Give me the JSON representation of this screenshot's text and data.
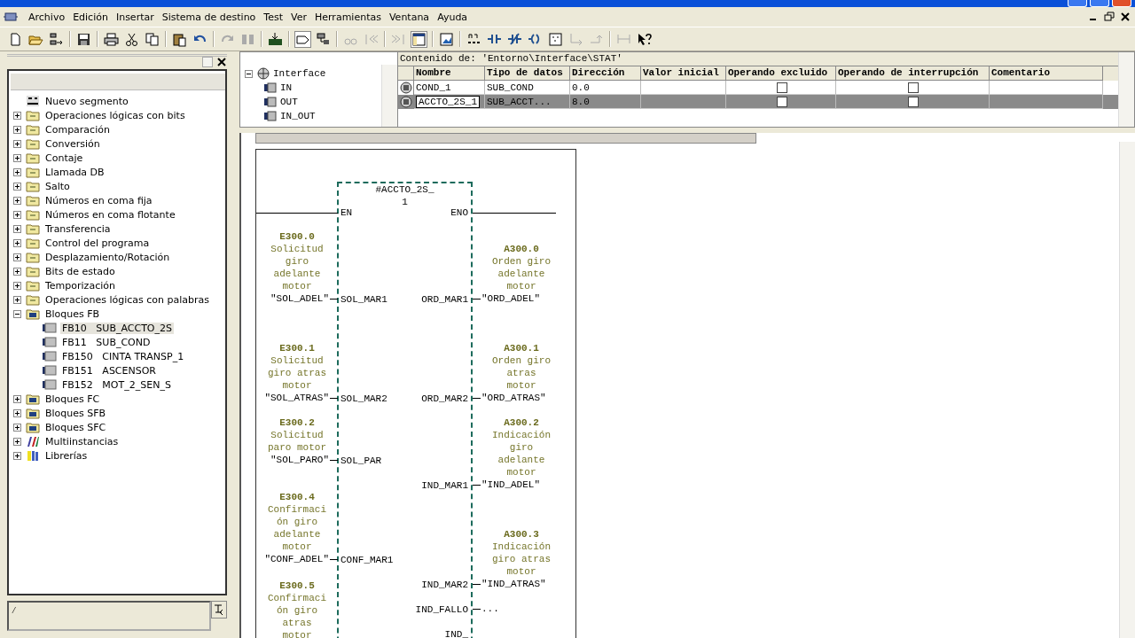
{
  "menu": [
    "Archivo",
    "Edición",
    "Insertar",
    "Sistema de destino",
    "Test",
    "Ver",
    "Herramientas",
    "Ventana",
    "Ayuda"
  ],
  "catalog": {
    "tree": [
      {
        "label": "Nuevo segmento",
        "kind": "segment"
      },
      {
        "label": "Operaciones lógicas con bits",
        "kind": "folder",
        "expanded": false
      },
      {
        "label": "Comparación",
        "kind": "folder",
        "expanded": false
      },
      {
        "label": "Conversión",
        "kind": "folder",
        "expanded": false
      },
      {
        "label": "Contaje",
        "kind": "folder",
        "expanded": false
      },
      {
        "label": "Llamada DB",
        "kind": "folder",
        "expanded": false
      },
      {
        "label": "Salto",
        "kind": "folder",
        "expanded": false
      },
      {
        "label": "Números en coma fija",
        "kind": "folder",
        "expanded": false
      },
      {
        "label": "Números en coma flotante",
        "kind": "folder",
        "expanded": false
      },
      {
        "label": "Transferencia",
        "kind": "folder",
        "expanded": false
      },
      {
        "label": "Control del programa",
        "kind": "folder",
        "expanded": false
      },
      {
        "label": "Desplazamiento/Rotación",
        "kind": "folder",
        "expanded": false
      },
      {
        "label": "Bits de estado",
        "kind": "folder",
        "expanded": false
      },
      {
        "label": "Temporización",
        "kind": "folder",
        "expanded": false
      },
      {
        "label": "Operaciones lógicas con palabras",
        "kind": "folder",
        "expanded": false
      },
      {
        "label": "Bloques FB",
        "kind": "block-folder",
        "expanded": true,
        "children": [
          {
            "label": "FB10   SUB_ACCTO_2S",
            "selected": true
          },
          {
            "label": "FB11   SUB_COND",
            "selected": false
          },
          {
            "label": "FB150   CINTA TRANSP_1",
            "selected": false
          },
          {
            "label": "FB151   ASCENSOR",
            "selected": false
          },
          {
            "label": "FB152   MOT_2_SEN_S",
            "selected": false
          }
        ]
      },
      {
        "label": "Bloques FC",
        "kind": "block-folder",
        "expanded": false
      },
      {
        "label": "Bloques SFB",
        "kind": "block-folder",
        "expanded": false
      },
      {
        "label": "Bloques SFC",
        "kind": "block-folder",
        "expanded": false
      },
      {
        "label": "Multiinstancias",
        "kind": "multi",
        "expanded": false
      },
      {
        "label": "Librerías",
        "kind": "library",
        "expanded": false
      }
    ],
    "input": {
      "value": "/"
    }
  },
  "interface": {
    "path": "Contenido de: 'Entorno\\Interface\\STAT'",
    "tree": {
      "label": "Interface",
      "expanded": true,
      "children": [
        "IN",
        "OUT",
        "IN_OUT"
      ]
    },
    "columns": [
      "Nombre",
      "Tipo de datos",
      "Dirección",
      "Valor inicial",
      "Operando excluido",
      "Operando de interrupción",
      "Comentario"
    ],
    "rows": [
      {
        "name": "COND_1",
        "type": "SUB_COND",
        "address": "0.0",
        "excluded": false,
        "interrupt": false,
        "selected": false
      },
      {
        "name": "ACCTO_2S_1",
        "type": "SUB_ACCT...",
        "address": "8.0",
        "excluded": false,
        "interrupt": false,
        "selected": true
      }
    ]
  },
  "diagram": {
    "instance": "#ACCTO_2S_1",
    "en": "EN",
    "eno": "ENO",
    "inputs": [
      {
        "address": "E300.0",
        "comment": "Solicitud giro adelante motor",
        "symbol": "\"SOL_ADEL\"",
        "pin": "SOL_MAR1"
      },
      {
        "address": "E300.1",
        "comment": "Solicitud giro atras motor",
        "symbol": "\"SOL_ATRAS\"",
        "pin": "SOL_MAR2"
      },
      {
        "address": "E300.2",
        "comment": "Solicitud paro motor",
        "symbol": "\"SOL_PARO\"",
        "pin": "SOL_PAR"
      },
      {
        "address": "E300.4",
        "comment": "Confirmación giro adelante motor",
        "symbol": "\"CONF_ADEL\"",
        "pin": "CONF_MAR1"
      },
      {
        "address": "E300.5",
        "comment": "Confirmación giro atras motor"
      }
    ],
    "outputs": [
      {
        "address": "A300.0",
        "comment": "Orden giro adelante motor",
        "symbol": "\"ORD_ADEL\"",
        "pin": "ORD_MAR1"
      },
      {
        "address": "A300.1",
        "comment": "Orden giro atras motor",
        "symbol": "\"ORD_ATRAS\"",
        "pin": "ORD_MAR2"
      },
      {
        "address": "A300.2",
        "comment": "Indicación giro adelante motor",
        "symbol": "\"IND_ADEL\"",
        "pin": "IND_MAR1"
      },
      {
        "address": "A300.3",
        "comment": "Indicación giro atras motor",
        "symbol": "\"IND_ATRAS\"",
        "pin": "IND_MAR2"
      },
      {
        "symbol": "...",
        "pin": "IND_FALLO"
      },
      {
        "pin": "IND_"
      }
    ]
  }
}
